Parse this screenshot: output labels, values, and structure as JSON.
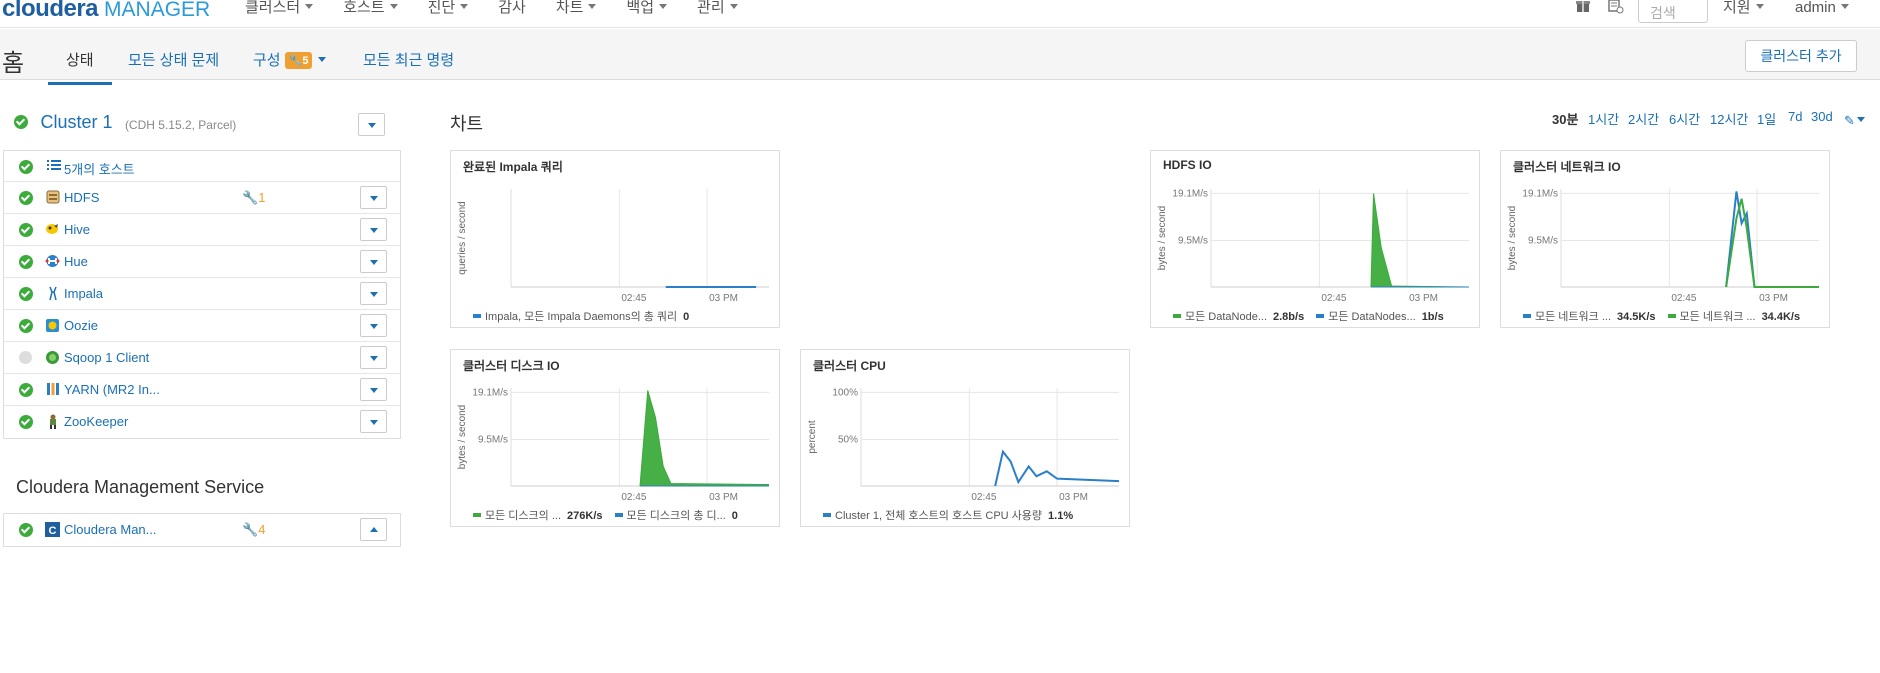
{
  "header": {
    "logo_main": "cloudera",
    "logo_sub": "MANAGER",
    "menu": [
      "클러스터",
      "호스트",
      "진단",
      "감사",
      "차트",
      "백업",
      "관리"
    ],
    "search_placeholder": "검색",
    "support": "지원",
    "user": "admin"
  },
  "subbar": {
    "title": "홈",
    "tabs": {
      "status": "상태",
      "issues": "모든 상태 문제",
      "config": "구성",
      "config_count": "5",
      "recent": "모든 최근 명령"
    },
    "add_cluster": "클러스터 추가"
  },
  "cluster": {
    "name": "Cluster 1",
    "version": "(CDH 5.15.2, Parcel)",
    "services": [
      {
        "label": "5개의 호스트",
        "icon": "list-icon",
        "status": "good",
        "cfg": "",
        "dropdown": false
      },
      {
        "label": "HDFS",
        "icon": "hdfs-icon",
        "status": "good",
        "cfg": "1",
        "dropdown": true
      },
      {
        "label": "Hive",
        "icon": "hive-icon",
        "status": "good",
        "cfg": "",
        "dropdown": true
      },
      {
        "label": "Hue",
        "icon": "hue-icon",
        "status": "good",
        "cfg": "",
        "dropdown": true
      },
      {
        "label": "Impala",
        "icon": "impala-icon",
        "status": "good",
        "cfg": "",
        "dropdown": true
      },
      {
        "label": "Oozie",
        "icon": "oozie-icon",
        "status": "good",
        "cfg": "",
        "dropdown": true
      },
      {
        "label": "Sqoop 1 Client",
        "icon": "sqoop-icon",
        "status": "none",
        "cfg": "",
        "dropdown": true
      },
      {
        "label": "YARN (MR2 In...",
        "icon": "yarn-icon",
        "status": "good",
        "cfg": "",
        "dropdown": true
      },
      {
        "label": "ZooKeeper",
        "icon": "zookeeper-icon",
        "status": "good",
        "cfg": "",
        "dropdown": true
      }
    ]
  },
  "mgmt": {
    "title": "Cloudera Management Service",
    "label": "Cloudera Man...",
    "cfg": "4"
  },
  "charts_header": {
    "title": "차트",
    "ranges": [
      "30분",
      "1시간",
      "2시간",
      "6시간",
      "12시간",
      "1일",
      "7d",
      "30d"
    ],
    "selected": "30분"
  },
  "colors": {
    "green": "#3cab3c",
    "blue": "#2a7fc9",
    "orange": "#f0a030",
    "link": "#1a6fb5"
  },
  "chart_data": [
    {
      "type": "line",
      "title": "완료된 Impala 쿼리",
      "ylabel": "queries / second",
      "x_ticks": [
        "02:45",
        "03 PM"
      ],
      "y_ticks": [],
      "series": [
        {
          "name": "Impala, 모든 Impala Daemons의 총 쿼리",
          "value": "0",
          "color": "#2a7fc9",
          "x": [
            0.6,
            0.95
          ],
          "y": [
            0,
            0
          ]
        }
      ]
    },
    {
      "type": "area",
      "title": "HDFS IO",
      "ylabel": "bytes / second",
      "x_ticks": [
        "02:45",
        "03 PM"
      ],
      "y_ticks": [
        "19.1M/s",
        "9.5M/s"
      ],
      "series": [
        {
          "name": "모든 DataNode...",
          "value": "2.8b/s",
          "color": "#3cab3c",
          "x": [
            0.62,
            0.63,
            0.66,
            0.7,
            1.0
          ],
          "y": [
            0,
            19.1,
            8,
            0.2,
            0
          ]
        },
        {
          "name": "모든 DataNodes...",
          "value": "1b/s",
          "color": "#2a7fc9",
          "x": [
            0.62,
            1.0
          ],
          "y": [
            0,
            0
          ]
        }
      ]
    },
    {
      "type": "line",
      "title": "클러스터 네트워크 IO",
      "ylabel": "bytes / second",
      "x_ticks": [
        "02:45",
        "03 PM"
      ],
      "y_ticks": [
        "19.1M/s",
        "9.5M/s"
      ],
      "series": [
        {
          "name": "모든 네트워크 ...",
          "value": "34.5K/s",
          "color": "#2a7fc9",
          "x": [
            0.64,
            0.68,
            0.7,
            0.72,
            0.75,
            1.0
          ],
          "y": [
            0,
            19.5,
            13,
            15,
            0,
            0
          ]
        },
        {
          "name": "모든 네트워크 ...",
          "value": "34.4K/s",
          "color": "#3cab3c",
          "x": [
            0.64,
            0.68,
            0.7,
            0.72,
            0.75,
            1.0
          ],
          "y": [
            0,
            14,
            18,
            12,
            0,
            0
          ]
        }
      ]
    },
    {
      "type": "area",
      "title": "클러스터 디스크 IO",
      "ylabel": "bytes / second",
      "x_ticks": [
        "02:45",
        "03 PM"
      ],
      "y_ticks": [
        "19.1M/s",
        "9.5M/s"
      ],
      "series": [
        {
          "name": "모든 디스크의 ...",
          "value": "276K/s",
          "color": "#3cab3c",
          "x": [
            0.5,
            0.53,
            0.56,
            0.59,
            0.62,
            1.0
          ],
          "y": [
            0,
            19.5,
            14,
            4,
            0.5,
            0.3
          ]
        },
        {
          "name": "모든 디스크의 총 디...",
          "value": "0",
          "color": "#2a7fc9",
          "x": [
            0.5,
            1.0
          ],
          "y": [
            0,
            0
          ]
        }
      ]
    },
    {
      "type": "line",
      "title": "클러스터 CPU",
      "ylabel": "percent",
      "x_ticks": [
        "02:45",
        "03 PM"
      ],
      "y_ticks": [
        "100%",
        "50%"
      ],
      "series": [
        {
          "name": "Cluster 1, 전체 호스트의 호스트 CPU 사용량",
          "value": "1.1%",
          "color": "#2a7fc9",
          "x": [
            0.52,
            0.55,
            0.58,
            0.61,
            0.65,
            0.68,
            0.72,
            0.76,
            1.0
          ],
          "y": [
            0,
            7,
            5,
            0.8,
            4,
            2,
            3,
            1.5,
            1
          ]
        }
      ]
    }
  ]
}
